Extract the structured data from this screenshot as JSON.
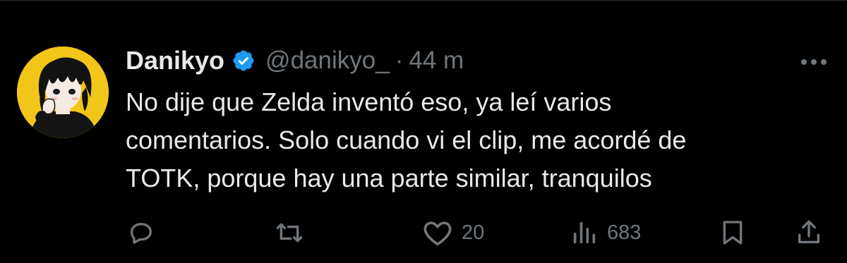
{
  "tweet": {
    "display_name": "Danikyo",
    "verified": true,
    "verified_color": "#1d9bf0",
    "handle": "@danikyo_",
    "separator": "·",
    "time": "44 m",
    "text_lines": [
      "No dije que Zelda inventó eso, ya leí varios",
      "comentarios. Solo cuando vi el clip, me acordé de",
      "TOTK, porque hay una parte similar, tranquilos"
    ]
  },
  "avatar": {
    "icon": "anime-avatar-icon",
    "background_color": "#f2c519"
  },
  "actions": {
    "reply": {
      "icon": "reply-icon",
      "count": ""
    },
    "retweet": {
      "icon": "retweet-icon",
      "count": ""
    },
    "like": {
      "icon": "heart-icon",
      "count": "20"
    },
    "views": {
      "icon": "views-icon",
      "count": "683"
    },
    "bookmark": {
      "icon": "bookmark-icon"
    },
    "share": {
      "icon": "share-icon"
    }
  },
  "colors": {
    "background": "#000000",
    "primary_text": "#e7e9ea",
    "secondary_text": "#71767b"
  }
}
